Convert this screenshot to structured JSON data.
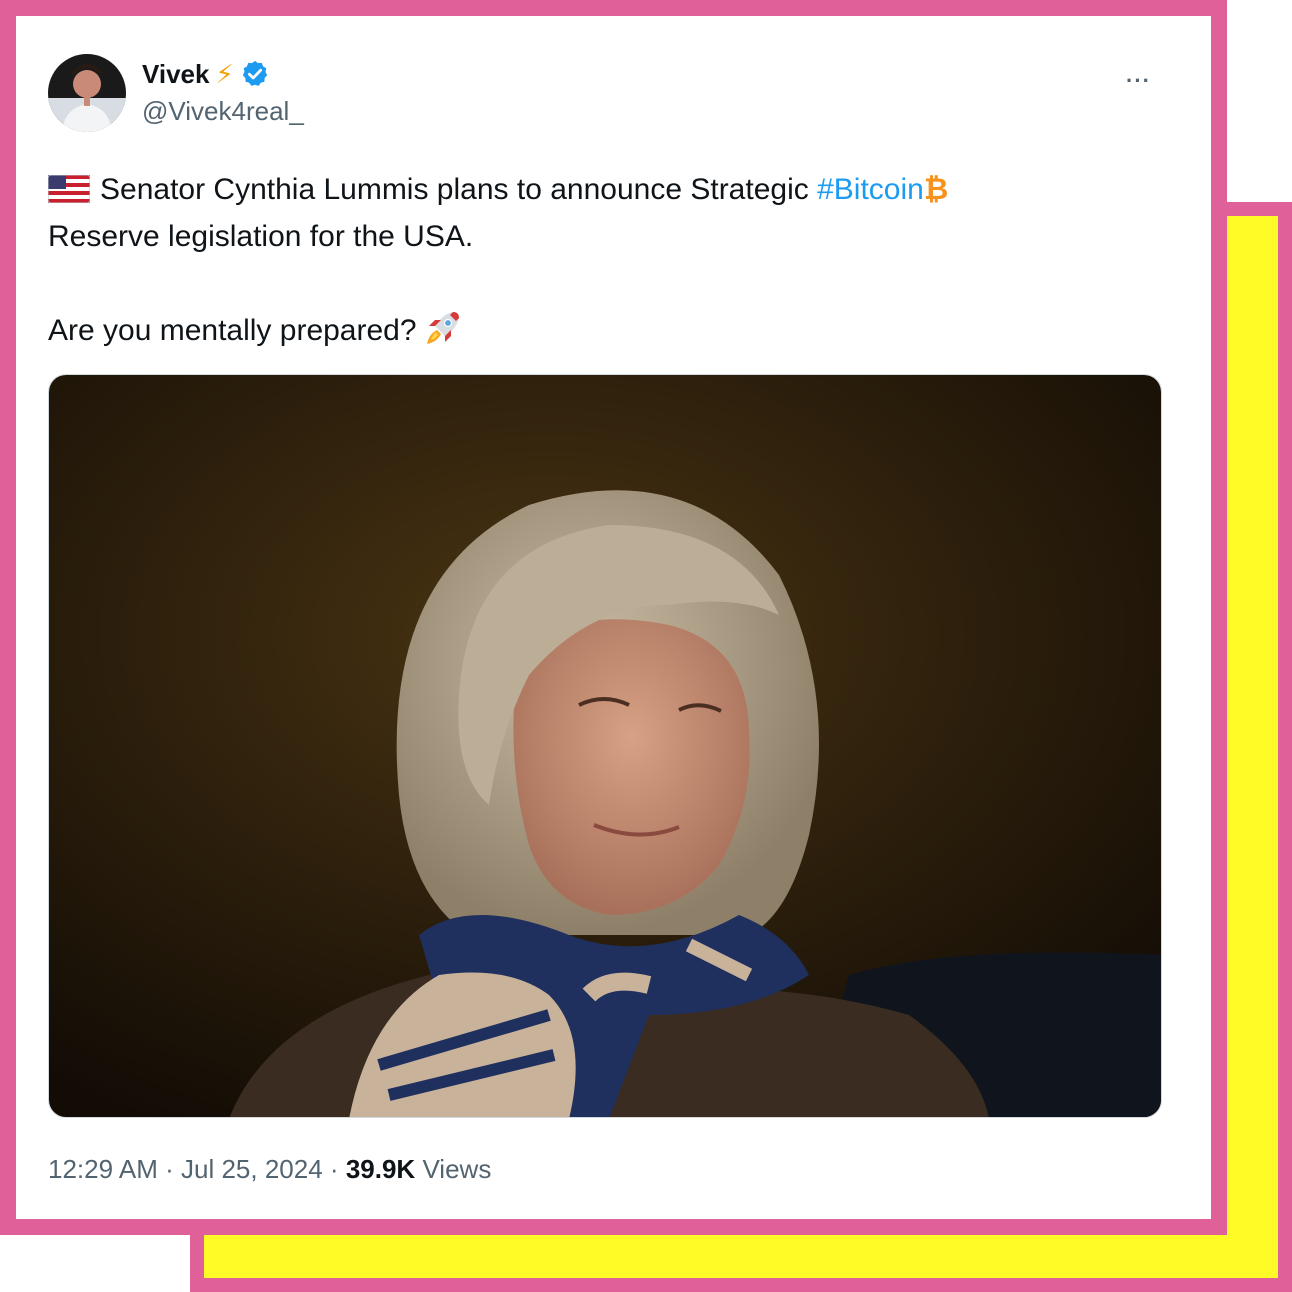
{
  "colors": {
    "frame_pink": "#e0609a",
    "frame_yellow": "#fffb26",
    "link_blue": "#1d9bf0",
    "bitcoin_orange": "#f7931a",
    "text_primary": "#0f1419",
    "text_secondary": "#536471"
  },
  "author": {
    "display_name": "Vivek",
    "name_emoji": "⚡",
    "handle": "@Vivek4real_",
    "verified_icon": "verified-badge-icon",
    "avatar_icon": "avatar"
  },
  "more_menu": {
    "label": "···",
    "icon": "more-options-icon"
  },
  "tweet": {
    "flag_icon": "us-flag-icon",
    "line1_text": "Senator Cynthia Lummis plans to announce Strategic",
    "hashtag": "#Bitcoin",
    "bitcoin_symbol": "₿",
    "line2_text": "Reserve legislation for the USA.",
    "question": "Are you mentally prepared?",
    "rocket_icon": "rocket-icon"
  },
  "media": {
    "photo_icon": "photo-of-woman-with-scarf"
  },
  "meta": {
    "time": "12:29 AM",
    "separator": "·",
    "date": "Jul 25, 2024",
    "views_count": "39.9K",
    "views_label": "Views"
  }
}
